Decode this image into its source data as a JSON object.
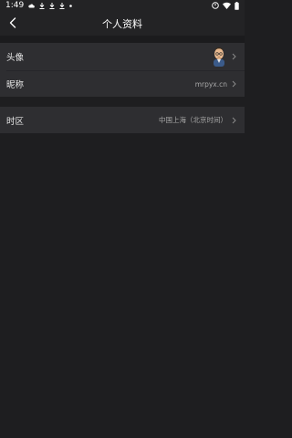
{
  "status_bar": {
    "time": "1:49",
    "left_icons": [
      "cloud-icon",
      "download-icon",
      "download-icon",
      "download-icon",
      "dot-icon"
    ],
    "right_icons": [
      "sync-icon",
      "wifi-icon",
      "battery-icon"
    ]
  },
  "header": {
    "title": "个人资料",
    "back_icon": "back-arrow-icon"
  },
  "profile": {
    "avatar_label": "头像",
    "nickname_label": "昵称",
    "nickname_value": "mrpyx.cn"
  },
  "settings": {
    "timezone_label": "时区",
    "timezone_value": "中国上海（北京时间）"
  },
  "colors": {
    "background": "#1e1e20",
    "card": "#2e2e31",
    "text_primary": "#e8e8e8",
    "text_secondary": "#a8a8a8"
  }
}
